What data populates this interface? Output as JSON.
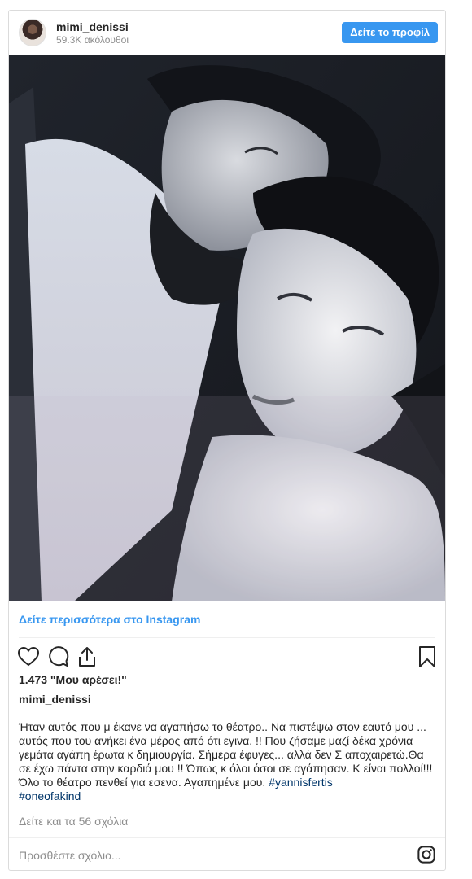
{
  "header": {
    "username": "mimi_denissi",
    "followers": "59.3K ακόλουθοι",
    "view_profile_label": "Δείτε το προφίλ"
  },
  "post": {
    "see_more_label": "Δείτε περισσότερα στο Instagram",
    "likes": "1.473 \"Μου αρέσει!\"",
    "author": "mimi_denissi",
    "caption_text": "Ήταν αυτός που μ έκανε να αγαπήσω το θέατρο.. Να πιστέψω στον εαυτό μου ... αυτός που του ανήκει ένα μέρος από ότι εγινα. !! Που ζήσαμε μαζί δέκα χρόνια γεμάτα αγάπη έρωτα κ δημιουργία. Σήμερα έφυγες... αλλά δεν Σ αποχαιρετώ.Θα σε έχω πάντα στην καρδιά μου !! Όπως κ όλοι όσοι σε αγάπησαν. Κ είναι πολλοί!!! Όλο το θέατρο πενθεί για εσενα. Αγαπημένε μου.",
    "hashtag_1": "#yannisfertis",
    "hashtag_2": "#oneofakind",
    "comments_link": "Δείτε και τα 56 σχόλια",
    "comment_placeholder": "Προσθέστε σχόλιο..."
  },
  "icons": {
    "like": "heart-icon",
    "comment": "comment-icon",
    "share": "share-icon",
    "save": "bookmark-icon",
    "brand": "instagram-icon"
  },
  "colors": {
    "accent": "#3897f0",
    "hashtag": "#003569",
    "muted": "#8e8e8e"
  }
}
